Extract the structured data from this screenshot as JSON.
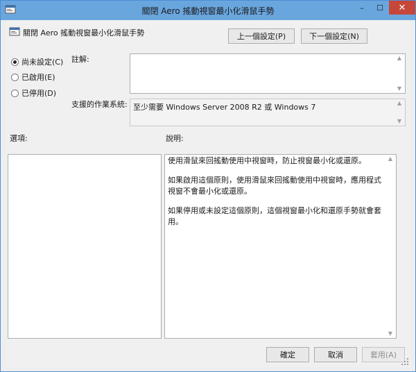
{
  "window": {
    "title": "關閉 Aero 搖動視窗最小化滑鼠手勢",
    "minimize": "–",
    "maximize": "☐",
    "close": "✕"
  },
  "header": {
    "setting_name": "關閉 Aero 搖動視窗最小化滑鼠手勢",
    "prev_button": "上一個設定(P)",
    "next_button": "下一個設定(N)"
  },
  "state": {
    "options": [
      {
        "label": "尚未設定(C)",
        "selected": true
      },
      {
        "label": "已啟用(E)",
        "selected": false
      },
      {
        "label": "已停用(D)",
        "selected": false
      }
    ]
  },
  "comment": {
    "label": "註解:",
    "value": ""
  },
  "supported": {
    "label": "支援的作業系統:",
    "value": "至少需要 Windows Server 2008 R2 或 Windows 7"
  },
  "options_panel": {
    "label": "選項:"
  },
  "help_panel": {
    "label": "說明:",
    "paragraphs": [
      "使用滑鼠來回搖動使用中視窗時，防止視窗最小化或還原。",
      "如果啟用這個原則，使用滑鼠來回搖動使用中視窗時，應用程式視窗不會最小化或還原。",
      "如果停用或未設定這個原則，這個視窗最小化和還原手勢就會套用。"
    ]
  },
  "footer": {
    "ok": "確定",
    "cancel": "取消",
    "apply": "套用(A)"
  },
  "icons": {
    "scroll_up": "▲",
    "scroll_down": "▼"
  }
}
